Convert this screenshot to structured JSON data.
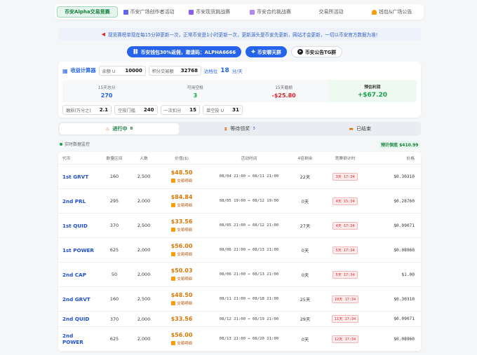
{
  "nav": {
    "tabs": [
      {
        "label": "币安Alpha交易竞赛",
        "icon": "none",
        "color": "#14803c"
      },
      {
        "label": "币安广场创作者活动",
        "icon": "grid-icon",
        "color": "#6366f1"
      },
      {
        "label": "币安现货挑战赛",
        "icon": "chart-icon",
        "color": "#8b5cf6"
      },
      {
        "label": "币安合约挑战赛",
        "icon": "doc-icon",
        "color": "#7c3aed"
      },
      {
        "label": "交易所活动",
        "icon": "none",
        "color": "#999"
      },
      {
        "label": "钱包&广场公告",
        "icon": "bell-icon",
        "color": "#f59e0b"
      }
    ]
  },
  "banner": {
    "text": "现货赛榜单现在每15分钟更新一次，正常币安是1小时更新一次，更新源头是币安先更新，网站才会更新，一切以币安官方数据为准!"
  },
  "buttons": {
    "wallet": "币安钱包30%返佣，邀请码：ALPHA6666",
    "group": "币安聊天群",
    "tg": "币安公告TG群"
  },
  "calculator": {
    "title": "收益计算器",
    "balance_label": "余额 U",
    "balance_value": "10000",
    "points_label": "积分交易额",
    "points_value": "32768",
    "rate_label": "达档位",
    "rate_value": "18",
    "rate_unit": "分/天",
    "stats": [
      {
        "label": "15天总分",
        "value": "270",
        "color": "#2563eb"
      },
      {
        "label": "可用空投",
        "value": "3",
        "color": "#16a34a"
      },
      {
        "label": "15天磨损",
        "value": "-$25.80",
        "color": "#dc2626"
      },
      {
        "label": "预估利润",
        "value": "+$67.20",
        "color": "#16a34a"
      }
    ],
    "params": [
      {
        "label": "磨损(万分之)",
        "value": "2.1"
      },
      {
        "label": "空投门槛",
        "value": "240"
      },
      {
        "label": "一次扣分",
        "value": "15"
      },
      {
        "label": "单空投 U",
        "value": "31"
      }
    ]
  },
  "status_tabs": [
    {
      "label": "进行中",
      "count": "8",
      "icon": "fire-icon"
    },
    {
      "label": "等待领奖",
      "count": "3",
      "icon": "hourglass-icon"
    },
    {
      "label": "已结束",
      "count": "",
      "icon": "folder-icon"
    }
  ],
  "monitor": {
    "label": "实时数据监控"
  },
  "profit_badge": "预计保底 $410.99",
  "table": {
    "headers": [
      "代币",
      "数量区间",
      "人数",
      "价值($)",
      "活动时间",
      "4倍剩余",
      "竞赛倒计时",
      "价格"
    ],
    "tag_label": "交易明细",
    "rows": [
      {
        "symbol": "1st GRVT",
        "qty": "160",
        "people": "2,500",
        "value": "$48.50",
        "time": "08/04 21:00 → 08/11 21:00",
        "remain": "22天",
        "countdown": "3天 17:34",
        "price": "$0.30310"
      },
      {
        "symbol": "2nd PRL",
        "qty": "295",
        "people": "2,000",
        "value": "$84.84",
        "time": "08/05 19:00 → 08/12 19:00",
        "remain": "0天",
        "countdown": "4天 15:34",
        "price": "$0.28760"
      },
      {
        "symbol": "1st QUID",
        "qty": "370",
        "people": "2,500",
        "value": "$33.56",
        "time": "08/05 21:00 → 08/12 21:00",
        "remain": "27天",
        "countdown": "4天 17:34",
        "price": "$0.09071"
      },
      {
        "symbol": "1st POWER",
        "qty": "625",
        "people": "2,000",
        "value": "$56.00",
        "time": "08/06 21:00 → 08/13 21:00",
        "remain": "0天",
        "countdown": "5天 17:34",
        "price": "$0.08960"
      },
      {
        "symbol": "2nd CAP",
        "qty": "50",
        "people": "2,000",
        "value": "$50.03",
        "time": "08/06 21:00 → 08/13 21:00",
        "remain": "0天",
        "countdown": "5天 17:34",
        "price": "$1.00"
      },
      {
        "symbol": "2nd GRVT",
        "qty": "160",
        "people": "2,500",
        "value": "$48.50",
        "time": "08/11 21:00 → 08/18 21:00",
        "remain": "25天",
        "countdown": "10天 17:34",
        "price": "$0.30310"
      },
      {
        "symbol": "2nd QUID",
        "qty": "370",
        "people": "2,000",
        "value": "$33.56",
        "time": "08/12 21:00 → 08/19 21:00",
        "remain": "29天",
        "countdown": "11天 17:34",
        "price": "$0.09071"
      },
      {
        "symbol": "2nd POWER",
        "qty": "625",
        "people": "2,000",
        "value": "$56.00",
        "time": "08/13 21:00 → 08/20 21:00",
        "remain": "0天",
        "countdown": "12天 17:34",
        "price": "$0.08960"
      }
    ]
  }
}
